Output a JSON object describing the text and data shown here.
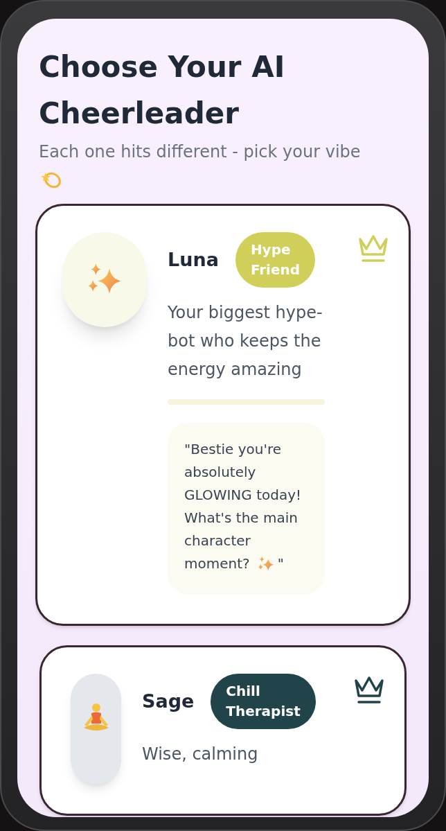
{
  "title": "Choose Your AI Cheerleader",
  "subtitle": "Each one hits different - pick your vibe",
  "cards": [
    {
      "name": "Luna",
      "badge": "Hype Friend",
      "color": "#cfcf5a",
      "avatar": {
        "kind": "sparkles"
      },
      "selected": true,
      "description": "Your biggest hype-bot who keeps the energy amazing",
      "quote": "\"Bestie you're absolutely GLOWING today! What's the main character",
      "quote_last_line": "moment?",
      "quote_end": "\""
    },
    {
      "name": "Sage",
      "badge": "Chill Therapist",
      "color": "#21434a",
      "avatar": {
        "kind": "meditation"
      },
      "selected": false,
      "description": "Wise, calming"
    }
  ]
}
